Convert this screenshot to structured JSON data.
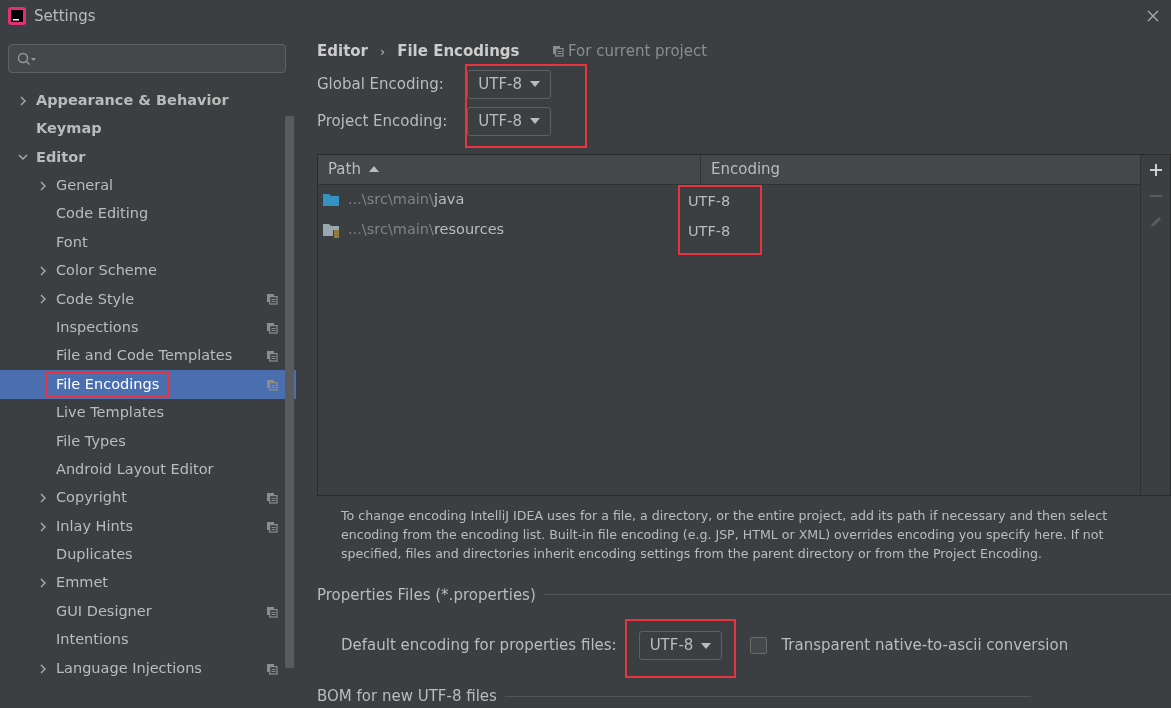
{
  "window": {
    "title": "Settings"
  },
  "sidebar": {
    "items": [
      {
        "label": "Appearance & Behavior",
        "bold": true,
        "kind": "group",
        "expanded": false,
        "selected": false,
        "project_scoped": false
      },
      {
        "label": "Keymap",
        "bold": true,
        "kind": "leaf",
        "selected": false,
        "project_scoped": false
      },
      {
        "label": "Editor",
        "bold": true,
        "kind": "group",
        "expanded": true,
        "selected": false,
        "project_scoped": false,
        "children": [
          {
            "label": "General",
            "kind": "group",
            "expanded": false,
            "selected": false,
            "project_scoped": false
          },
          {
            "label": "Code Editing",
            "kind": "leaf",
            "selected": false,
            "project_scoped": false
          },
          {
            "label": "Font",
            "kind": "leaf",
            "selected": false,
            "project_scoped": false
          },
          {
            "label": "Color Scheme",
            "kind": "group",
            "expanded": false,
            "selected": false,
            "project_scoped": false
          },
          {
            "label": "Code Style",
            "kind": "group",
            "expanded": false,
            "selected": false,
            "project_scoped": true
          },
          {
            "label": "Inspections",
            "kind": "leaf",
            "selected": false,
            "project_scoped": true
          },
          {
            "label": "File and Code Templates",
            "kind": "leaf",
            "selected": false,
            "project_scoped": true
          },
          {
            "label": "File Encodings",
            "kind": "leaf",
            "selected": true,
            "highlighted": true,
            "project_scoped": true
          },
          {
            "label": "Live Templates",
            "kind": "leaf",
            "selected": false,
            "project_scoped": false
          },
          {
            "label": "File Types",
            "kind": "leaf",
            "selected": false,
            "project_scoped": false
          },
          {
            "label": "Android Layout Editor",
            "kind": "leaf",
            "selected": false,
            "project_scoped": false
          },
          {
            "label": "Copyright",
            "kind": "group",
            "expanded": false,
            "selected": false,
            "project_scoped": true
          },
          {
            "label": "Inlay Hints",
            "kind": "group",
            "expanded": false,
            "selected": false,
            "project_scoped": true
          },
          {
            "label": "Duplicates",
            "kind": "leaf",
            "selected": false,
            "project_scoped": false
          },
          {
            "label": "Emmet",
            "kind": "group",
            "expanded": false,
            "selected": false,
            "project_scoped": false
          },
          {
            "label": "GUI Designer",
            "kind": "leaf",
            "selected": false,
            "project_scoped": true
          },
          {
            "label": "Intentions",
            "kind": "leaf",
            "selected": false,
            "project_scoped": false
          },
          {
            "label": "Language Injections",
            "kind": "group",
            "expanded": false,
            "selected": false,
            "project_scoped": true
          }
        ]
      }
    ]
  },
  "breadcrumb": {
    "items": [
      "Editor",
      "File Encodings"
    ],
    "separator": "›",
    "scope": "For current project"
  },
  "encodings": {
    "highlighted": true,
    "fields": [
      {
        "label": "Global Encoding:",
        "value": "UTF-8"
      },
      {
        "label": "Project Encoding:",
        "value": "UTF-8"
      }
    ]
  },
  "table": {
    "columns": [
      {
        "label": "Path",
        "sorted": true
      },
      {
        "label": "Encoding",
        "sorted": false
      }
    ],
    "encoding_column_highlighted": true,
    "rows": [
      {
        "kind": "source",
        "path_prefix": "...\\src\\main\\",
        "path_name": "java",
        "encoding": "UTF-8"
      },
      {
        "kind": "resources",
        "path_prefix": "...\\src\\main\\",
        "path_name": "resources",
        "encoding": "UTF-8"
      }
    ]
  },
  "toolbar": {
    "add_enabled": true,
    "remove_enabled": false,
    "edit_enabled": false
  },
  "help_text": "To change encoding IntelliJ IDEA uses for a file, a directory, or the entire project, add its path if necessary and then select encoding from the encoding list. Built-in file encoding (e.g. JSP, HTML or XML) overrides encoding you specify here. If not specified, files and directories inherit encoding settings from the parent directory or from the Project Encoding.",
  "properties": {
    "title": "Properties Files (*.properties)",
    "label": "Default encoding for properties files:",
    "value": "UTF-8",
    "highlighted": true,
    "checkbox": {
      "label": "Transparent native-to-ascii conversion",
      "checked": false
    }
  },
  "bom": {
    "title": "BOM for new UTF-8 files"
  }
}
